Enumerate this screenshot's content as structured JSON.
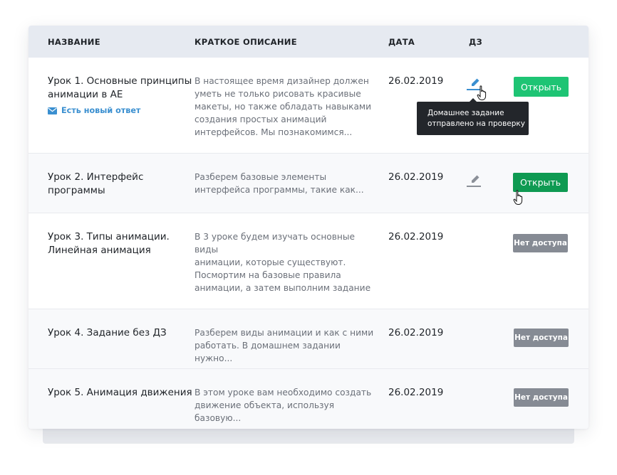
{
  "header": {
    "col_name": "НАЗВАНИЕ",
    "col_desc": "КРАТКОЕ ОПИСАНИЕ",
    "col_date": "ДАТА",
    "col_hw": "ДЗ"
  },
  "lessons": [
    {
      "title_line1": "Урок 1. Основные принципы",
      "title_line2": "анимации в AE",
      "new_answer": "Есть новый ответ",
      "desc": [
        "В настоящее время дизайнер должен",
        "уметь не только рисовать красивые",
        "макеты, но также обладать навыками",
        "создания простых анимаций",
        "интерфейсов. Мы познакомимся..."
      ],
      "date": "26.02.2019",
      "action": "Открыть"
    },
    {
      "title_line1": "Урок 2. Интерфейс",
      "title_line2": "программы",
      "desc": [
        "Разберем базовые элементы",
        "интерфейса программы, такие как..."
      ],
      "date": "26.02.2019",
      "action": "Открыть"
    },
    {
      "title_line1": "Урок 3. Типы анимации.",
      "title_line2": "Линейная анимация",
      "desc": [
        "В 3 уроке будем изучать основные виды",
        "анимации, которые существуют.",
        "Посмортим на базовые правила",
        "анимации, а затем выполним задание"
      ],
      "date": "26.02.2019",
      "action": "Нет доступа"
    },
    {
      "title_line1": "Урок 4. Задание без ДЗ",
      "desc": [
        "Разберем виды анимации и как с ними",
        "работать. В домашнем задании нужно..."
      ],
      "date": "26.02.2019",
      "action": "Нет доступа"
    },
    {
      "title_line1": "Урок 5. Анимация движения",
      "desc": [
        "В этом уроке вам необходимо создать",
        "движение объекта, используя базовую..."
      ],
      "date": "26.02.2019",
      "action": "Нет доступа"
    }
  ],
  "tooltip": {
    "line1": "Домашнее задание",
    "line2": "отправлено на проверку"
  },
  "colors": {
    "open_button": "#1ec474",
    "open_button_hover": "#0f9a52",
    "locked_button": "#868b94",
    "link": "#3a8fd0",
    "header_bg": "#e6eaf1"
  },
  "icons": [
    "pencil-icon",
    "mail-icon",
    "hand-cursor-icon"
  ]
}
